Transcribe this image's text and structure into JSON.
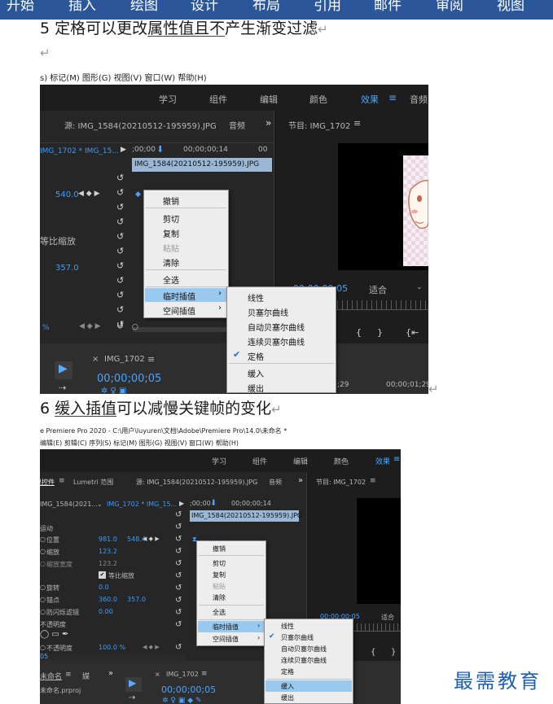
{
  "ribbon": {
    "tabs": [
      "开始",
      "插入",
      "绘图",
      "设计",
      "布局",
      "引用",
      "邮件",
      "审阅",
      "视图"
    ]
  },
  "doc": {
    "para1": {
      "pre": "5 定格可以更改",
      "underlined": "属性值且不",
      "post": "产生渐变过滤",
      "mark": "↵"
    },
    "empty_mark": "↵",
    "shot1_mark": "↵",
    "para2": {
      "pre": "6 ",
      "underlined": "缓入插值",
      "post": "可以减慢关键帧的变化",
      "mark": "↵"
    }
  },
  "shot1": {
    "menubar": "s) 标记(M) 图形(G) 视图(V) 窗口(W) 帮助(H)",
    "workspaces": [
      "学习",
      "组件",
      "编辑",
      "颜色",
      "效果",
      "音频"
    ],
    "workspace_menu_icon": "≡",
    "source_tab": "源: IMG_1584(20210512-195959).JPG",
    "audio_tab": "音频",
    "more": "»",
    "program_tab": "节目: IMG_1702",
    "program_menu_icon": "≡",
    "clip_select": "IMG_1702 * IMG_15...",
    "tc_start": ";00;00",
    "tc_mid": "00;00;00;14",
    "tc_end": "00",
    "clip_bar": "IMG_1584(20210512-195959).JPG",
    "value_540": "540.0",
    "label_scale": "等比缩放",
    "value_357": "357.0",
    "percent": "%",
    "fit_label": "适合",
    "program_tc": "00;00;00;05",
    "timeline_tab": "IMG_1702",
    "timeline_tc": "00;00;00;05",
    "tc_29": ";29",
    "tc_01_29": "00;00;01;29",
    "close_x": "×",
    "context": {
      "items": [
        "撤销",
        "剪切",
        "复制",
        "粘贴",
        "清除",
        "全选",
        "临时插值",
        "空间插值"
      ],
      "submenu": [
        "线性",
        "贝塞尔曲线",
        "自动贝塞尔曲线",
        "连续贝塞尔曲线",
        "定格",
        "缓入",
        "缓出"
      ],
      "checked": "定格"
    }
  },
  "shot2": {
    "title": "e Premiere Pro 2020 - C:\\用户\\luyuren\\文档\\Adobe\\Premiere Pro\\14.0\\未命名 *",
    "menubar": "编辑(E) 剪辑(C) 序列(S) 标记(M) 图形(G) 视图(V) 窗口(W) 帮助(H)",
    "workspaces": [
      "学习",
      "组件",
      "编辑",
      "颜色",
      "效果"
    ],
    "workspace_menu_icon": "≡",
    "panel_tabs": [
      "效果控件",
      "Lumetri 范围"
    ],
    "source_tab": "源: IMG_1584(20210512-195959).JPG",
    "audio_tab": "音频",
    "more": "»",
    "program_tab": "节目: IMG_1702",
    "program_menu_icon": "≡",
    "clip_select_left": "IMG_1584(2021...",
    "clip_select_right": "IMG_1702 * IMG_15...",
    "tc_start": ";00;00",
    "tc_mid": "00;00;00;14",
    "clip_bar": "IMG_1584(20210512-195959).JPG",
    "section_motion": "运动",
    "properties": [
      {
        "name": "位置",
        "v1": "981.0",
        "v2": "548.4"
      },
      {
        "name": "缩放",
        "v1": "123.2",
        "v2": ""
      },
      {
        "name": "缩放宽度",
        "v1": "123.2",
        "v2": ""
      },
      {
        "name": "等比缩放",
        "v1": "",
        "v2": ""
      },
      {
        "name": "旋转",
        "v1": "0.0",
        "v2": ""
      },
      {
        "name": "锚点",
        "v1": "360.0",
        "v2": "357.0"
      },
      {
        "name": "防闪烁滤镜",
        "v1": "0.00",
        "v2": ""
      },
      {
        "name": "不透明度",
        "v1": "",
        "v2": ""
      },
      {
        "name": "不透明度",
        "v1": "100.0 %",
        "v2": ""
      }
    ],
    "tc_bottom": "05",
    "project_tab": "未命名",
    "project_tab2": "媒",
    "project_file": "未命名.prproj",
    "program_tc": "00;00;00;05",
    "fit_label": "适合",
    "timeline_tab": "IMG_1702",
    "timeline_tc": "00;00;00;05",
    "close_x": "×",
    "context": {
      "items": [
        "撤销",
        "剪切",
        "复制",
        "粘贴",
        "清除",
        "全选",
        "临时插值",
        "空间插值"
      ],
      "submenu": [
        "线性",
        "贝塞尔曲线",
        "自动贝塞尔曲线",
        "连续贝塞尔曲线",
        "定格",
        "缓入",
        "缓出"
      ],
      "checked": "贝塞尔曲线",
      "highlighted": "缓入"
    }
  },
  "watermark": "最需教育"
}
